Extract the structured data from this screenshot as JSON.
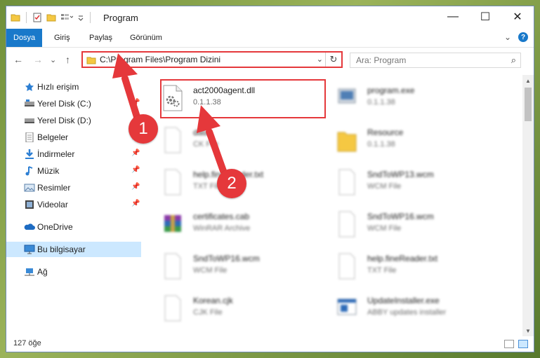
{
  "window": {
    "title": "Program",
    "minimize": "—",
    "maximize": "☐",
    "close": "✕"
  },
  "ribbon": {
    "tabs": [
      {
        "label": "Dosya"
      },
      {
        "label": "Giriş"
      },
      {
        "label": "Paylaş"
      },
      {
        "label": "Görünüm"
      }
    ],
    "collapse": "⌄",
    "help": "?"
  },
  "address_bar": {
    "path": "C:\\Program Files\\Program Dizini",
    "dropdown": "⌄",
    "refresh": "↻"
  },
  "search": {
    "placeholder": "Ara: Program",
    "icon": "⌕"
  },
  "nav": {
    "back": "←",
    "forward": "→",
    "recent": "⌄",
    "up": "↑",
    "items": [
      {
        "label": "Hızlı erişim",
        "icon": "star-icon"
      },
      {
        "label": "Yerel Disk (C:)",
        "icon": "drive-icon",
        "pinned": true
      },
      {
        "label": "Yerel Disk (D:)",
        "icon": "drive-icon",
        "pinned": true
      },
      {
        "label": "Belgeler",
        "icon": "documents-icon",
        "pinned": true
      },
      {
        "label": "İndirmeler",
        "icon": "downloads-icon",
        "pinned": true
      },
      {
        "label": "Müzik",
        "icon": "music-icon",
        "pinned": true
      },
      {
        "label": "Resimler",
        "icon": "pictures-icon",
        "pinned": true
      },
      {
        "label": "Videolar",
        "icon": "videos-icon",
        "pinned": true
      },
      {
        "label": "OneDrive",
        "icon": "cloud-icon"
      },
      {
        "label": "Bu bilgisayar",
        "icon": "computer-icon",
        "selected": true
      },
      {
        "label": "Ağ",
        "icon": "network-icon"
      }
    ]
  },
  "files": [
    {
      "name": "act2000agent.dll",
      "sub": "0.1.1.38",
      "icon": "dll-gear-icon",
      "highlighted": true
    },
    {
      "name": "program.exe",
      "sub": "0.1.1.38",
      "icon": "exe-icon"
    },
    {
      "name": "data",
      "sub": "CK File",
      "icon": "file-icon"
    },
    {
      "name": "Resource",
      "sub": "0.1.1.38",
      "icon": "folder-icon"
    },
    {
      "name": "help.fineReader.txt",
      "sub": "TXT File",
      "icon": "file-icon"
    },
    {
      "name": "SndToWP13.wcm",
      "sub": "WCM File",
      "icon": "file-icon"
    },
    {
      "name": "certificates.cab",
      "sub": "WinRAR Archive",
      "icon": "archive-icon"
    },
    {
      "name": "SndToWP16.wcm",
      "sub": "WCM File",
      "icon": "file-icon"
    },
    {
      "name": "SndToWP16.wcm",
      "sub": "WCM File",
      "icon": "file-icon"
    },
    {
      "name": "help.fineReader.txt",
      "sub": "TXT File",
      "icon": "file-icon"
    },
    {
      "name": "Korean.cjk",
      "sub": "CJK File",
      "icon": "file-icon"
    },
    {
      "name": "UpdateInstaller.exe",
      "sub": "ABBY updates installer",
      "icon": "installer-icon"
    }
  ],
  "status": {
    "count": "127 öğe"
  },
  "annotations": [
    {
      "number": "1"
    },
    {
      "number": "2"
    }
  ],
  "colors": {
    "accent": "#1979ca",
    "annotation": "#e5383b",
    "selection": "#cce8ff"
  }
}
